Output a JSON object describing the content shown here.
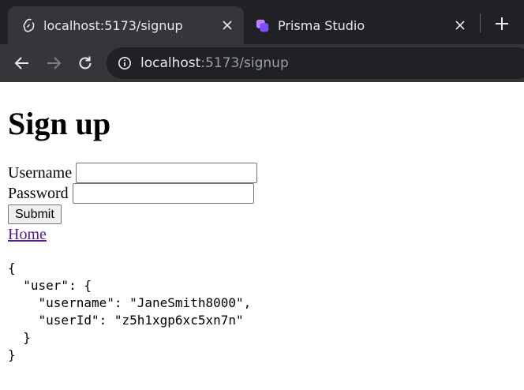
{
  "browser": {
    "tabs": [
      {
        "title": "localhost:5173/signup",
        "active": true,
        "favicon": "svelte-icon"
      },
      {
        "title": "Prisma Studio",
        "active": false,
        "favicon": "prisma-icon"
      }
    ],
    "address": {
      "host": "localhost",
      "path": ":5173/signup"
    }
  },
  "page": {
    "heading": "Sign up",
    "form": {
      "username_label": "Username",
      "username_value": "",
      "password_label": "Password",
      "password_value": "",
      "submit_label": "Submit"
    },
    "home_link": "Home",
    "json_output": "{\n  \"user\": {\n    \"username\": \"JaneSmith8000\",\n    \"userId\": \"z5h1xgp6xc5xn7n\"\n  }\n}"
  }
}
